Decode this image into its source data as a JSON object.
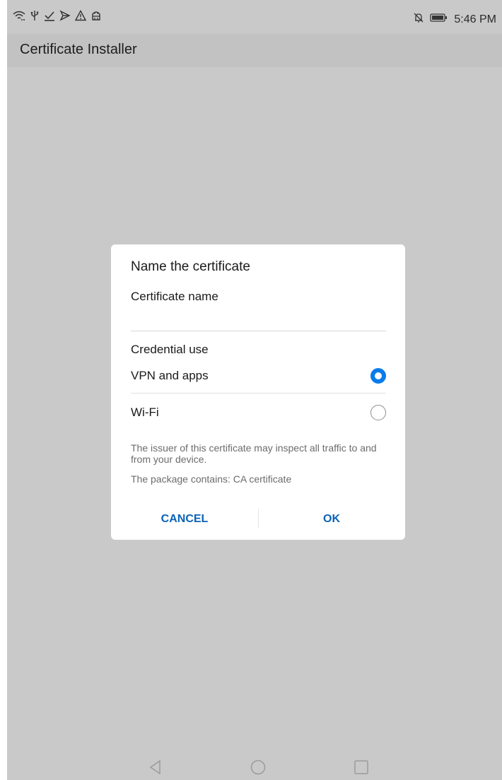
{
  "status_bar": {
    "left_icons": [
      "wifi-icon",
      "usb-icon",
      "download-done-icon",
      "cast-icon",
      "warning-icon",
      "android-debug-icon"
    ],
    "right_icons": [
      "bell-off-icon",
      "battery-icon"
    ],
    "time": "5:46 PM"
  },
  "app_bar": {
    "title": "Certificate Installer"
  },
  "dialog": {
    "title": "Name the certificate",
    "name_label": "Certificate name",
    "name_value": "",
    "credential_label": "Credential use",
    "options": [
      {
        "label": "VPN and apps",
        "selected": true
      },
      {
        "label": "Wi-Fi",
        "selected": false
      }
    ],
    "note_traffic": "The issuer of this certificate may inspect all traffic to and from your device.",
    "note_package": "The package contains: CA certificate",
    "cancel_label": "CANCEL",
    "ok_label": "OK",
    "accent_color": "#0a7bea",
    "button_color": "#0a62b7"
  },
  "nav_bar": {
    "icons": [
      "back-icon",
      "home-icon",
      "recent-apps-icon"
    ]
  }
}
